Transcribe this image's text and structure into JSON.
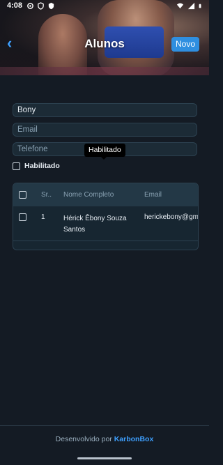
{
  "status_bar": {
    "time": "4:08",
    "left_icons": [
      "gear-icon",
      "shield-icon",
      "shield-check-icon"
    ],
    "right_icons": [
      "wifi-icon",
      "signal-icon",
      "battery-icon"
    ]
  },
  "header": {
    "title": "Alunos",
    "back_icon": "chevron-left-icon",
    "new_button_label": "Novo"
  },
  "form": {
    "name_value": "Bony",
    "email_placeholder": "Email",
    "phone_placeholder": "Telefone",
    "enabled_label": "Habilitado",
    "tooltip": "Habilitado"
  },
  "table": {
    "columns": [
      "Sr..",
      "Nome Completo",
      "Email"
    ],
    "rows": [
      {
        "sr": "1",
        "name": "Hérick Êbony Souza Santos",
        "email": "herickebony@gm"
      }
    ]
  },
  "footer": {
    "prefix": "Desenvolvido por ",
    "brand": "KarbonBox"
  },
  "colors": {
    "accent": "#2f8fe0",
    "background": "#141b24",
    "field_bg": "#1c2b36"
  }
}
